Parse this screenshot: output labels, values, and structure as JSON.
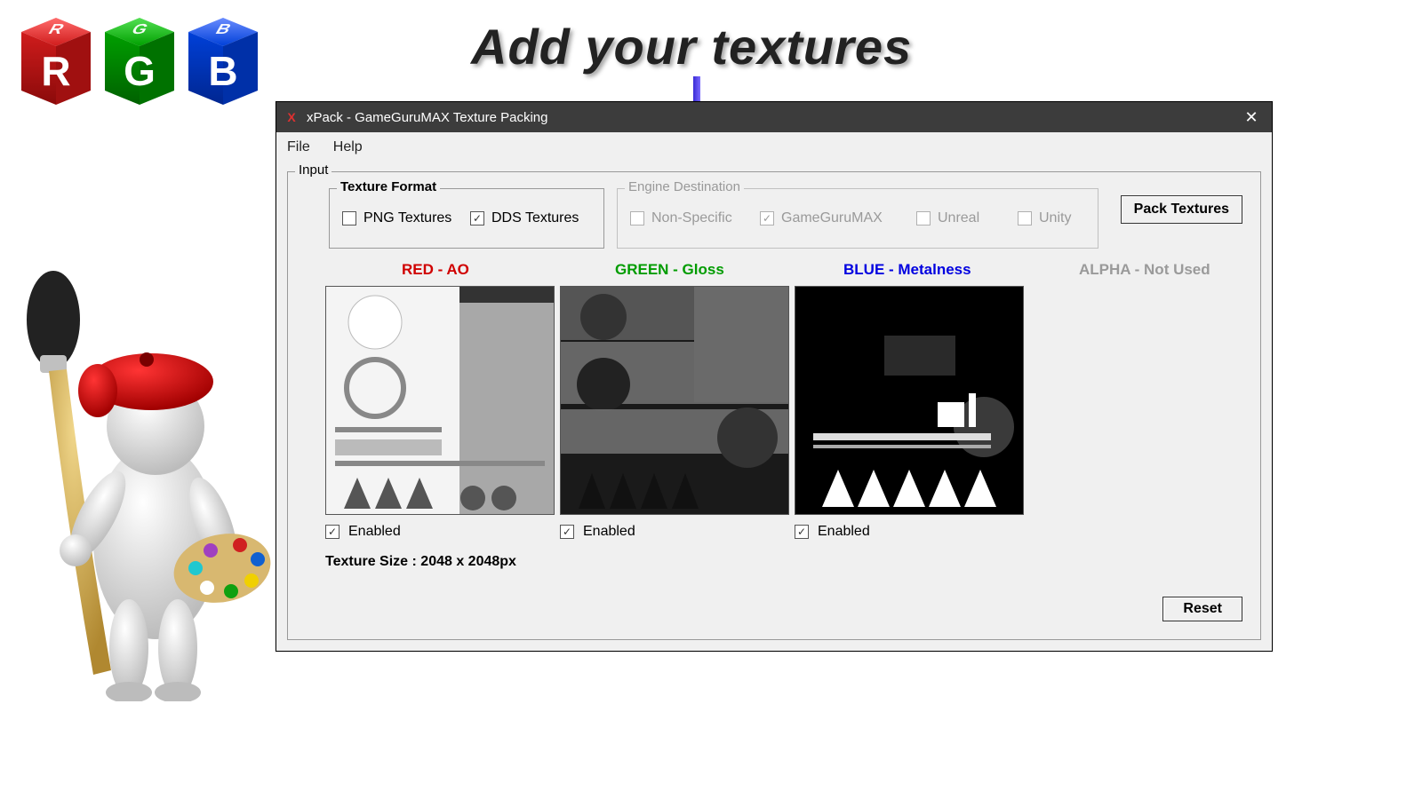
{
  "headline": "Add your textures",
  "cubes": {
    "letters": [
      "R",
      "G",
      "B"
    ],
    "colors": [
      "#d01c1c",
      "#00a000",
      "#0040d8"
    ]
  },
  "window": {
    "title": "xPack - GameGuruMAX Texture Packing",
    "menu": {
      "file": "File",
      "help": "Help"
    }
  },
  "input": {
    "legend": "Input",
    "texture_format": {
      "legend": "Texture Format",
      "png": {
        "label": "PNG Textures",
        "checked": false
      },
      "dds": {
        "label": "DDS Textures",
        "checked": true
      }
    },
    "engine_destination": {
      "legend": "Engine Destination",
      "nonspecific": {
        "label": "Non-Specific",
        "checked": false
      },
      "ggmax": {
        "label": "GameGuruMAX",
        "checked": true
      },
      "unreal": {
        "label": "Unreal",
        "checked": false
      },
      "unity": {
        "label": "Unity",
        "checked": false
      }
    },
    "pack_button": "Pack Textures",
    "channels": {
      "red": {
        "header": "RED - AO",
        "enabled_label": "Enabled",
        "enabled": true
      },
      "green": {
        "header": "GREEN - Gloss",
        "enabled_label": "Enabled",
        "enabled": true
      },
      "blue": {
        "header": "BLUE - Metalness",
        "enabled_label": "Enabled",
        "enabled": true
      },
      "alpha": {
        "header": "ALPHA - Not Used"
      }
    },
    "texture_size": "Texture Size : 2048 x 2048px",
    "reset_button": "Reset"
  }
}
